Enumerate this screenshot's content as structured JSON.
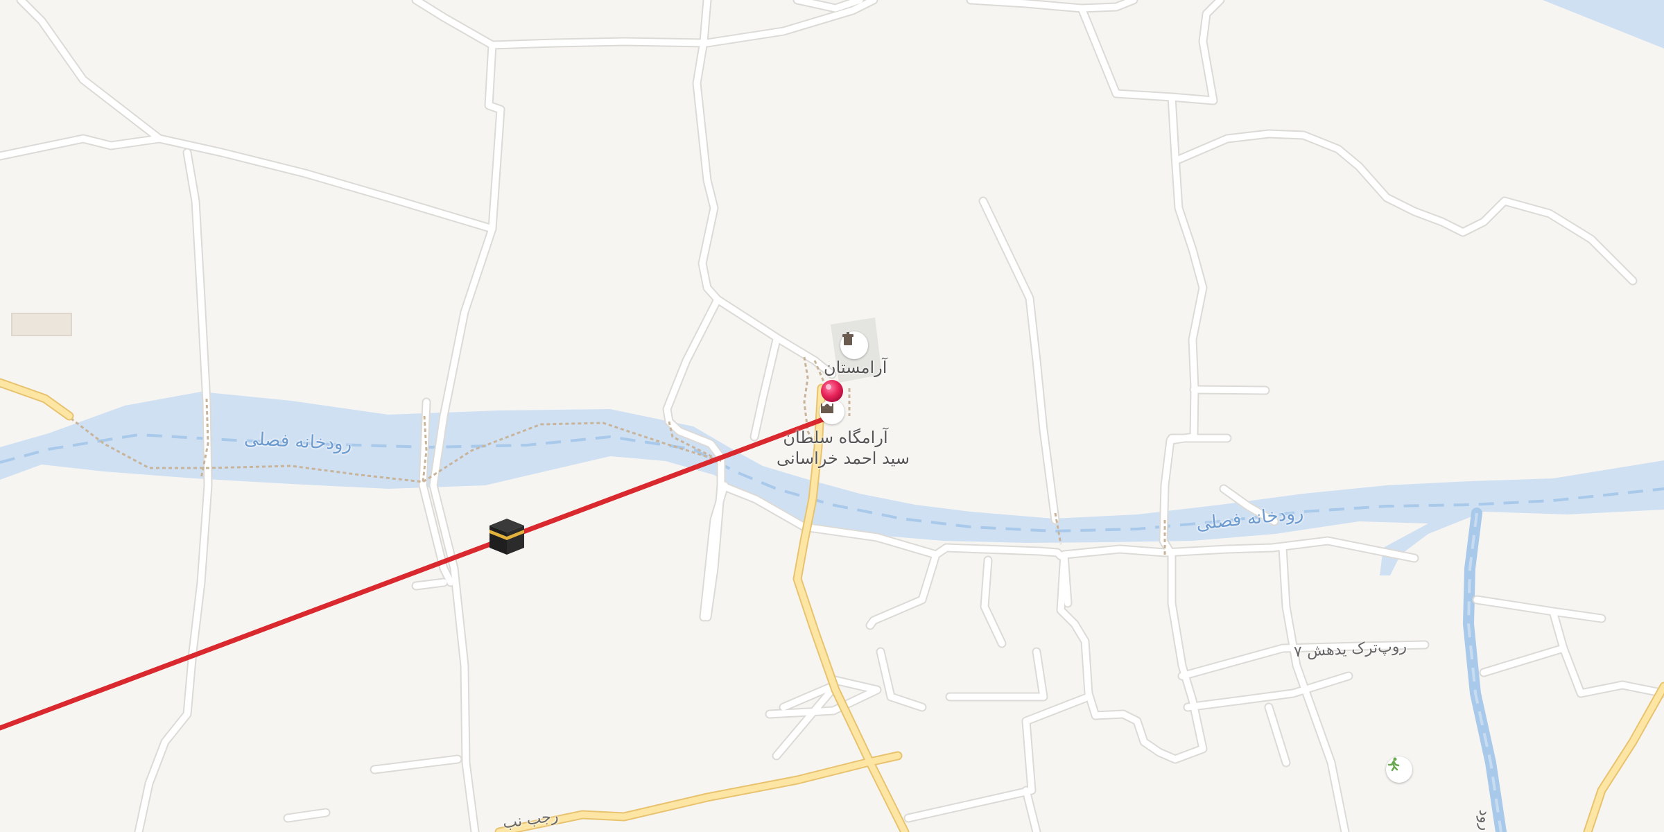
{
  "map": {
    "labels": {
      "river_west": "رودخانه فصلی",
      "river_east": "رودخانه فصلی",
      "cemetery": "آرامستان",
      "mausoleum_line1": "آرامگاه سلطان",
      "mausoleum_line2": "سید احمد خراسانی",
      "street_east": "۷ روپ‌ترک یدهش",
      "street_bottom": "رجب نب",
      "street_far_right": "رود"
    },
    "icons": {
      "cemetery": "cemetery-icon",
      "mausoleum": "mausoleum-icon",
      "kaaba": "kaaba-icon",
      "location_pin": "location-pin-icon",
      "park": "running-person-icon"
    },
    "colors": {
      "background": "#f7f5f2",
      "river": "#cfe0f3",
      "river_dash": "#a9c9ea",
      "road": "#ffffff",
      "road_casing": "#dcdad6",
      "major_road": "#fde6a4",
      "major_road_casing": "#e8c36f",
      "qibla_line": "#d9282e",
      "pin": "#e8245a",
      "footpath": "#c8b49a"
    }
  }
}
